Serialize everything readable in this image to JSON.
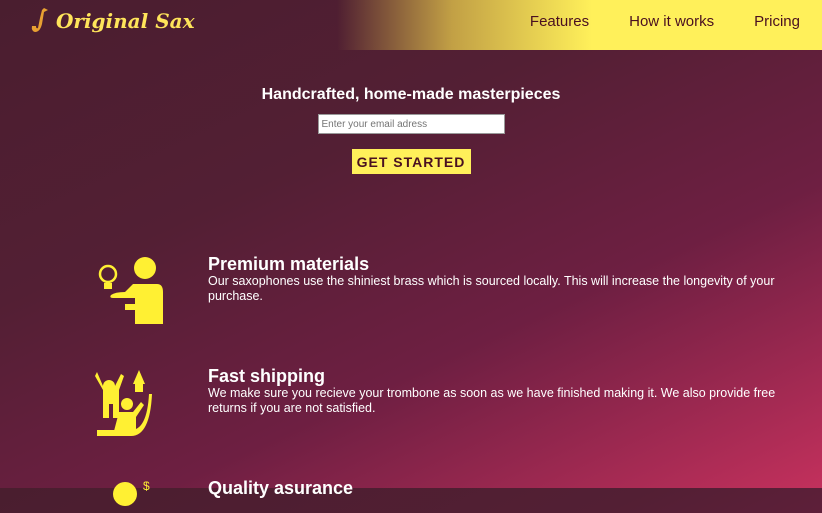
{
  "header": {
    "logo_text": "Original Sax",
    "nav": [
      "Features",
      "How it works",
      "Pricing"
    ]
  },
  "hero": {
    "title": "Handcrafted, home-made masterpieces",
    "email_placeholder": "Enter your email adress",
    "cta": "GET STARTED"
  },
  "features": [
    {
      "title": "Premium materials",
      "text": "Our saxophones use the shiniest brass which is sourced locally. This will increase the longevity of your purchase.",
      "icon": "idea-person-icon"
    },
    {
      "title": "Fast shipping",
      "text": "We make sure you recieve your trombone as soon as we have finished making it. We also provide free returns if you are not satisfied.",
      "icon": "rocket-celebration-icon"
    },
    {
      "title": "Quality asurance",
      "text": "",
      "icon": "money-quality-icon"
    }
  ],
  "colors": {
    "accent": "#fff05a",
    "nav_text": "#4a1020"
  }
}
